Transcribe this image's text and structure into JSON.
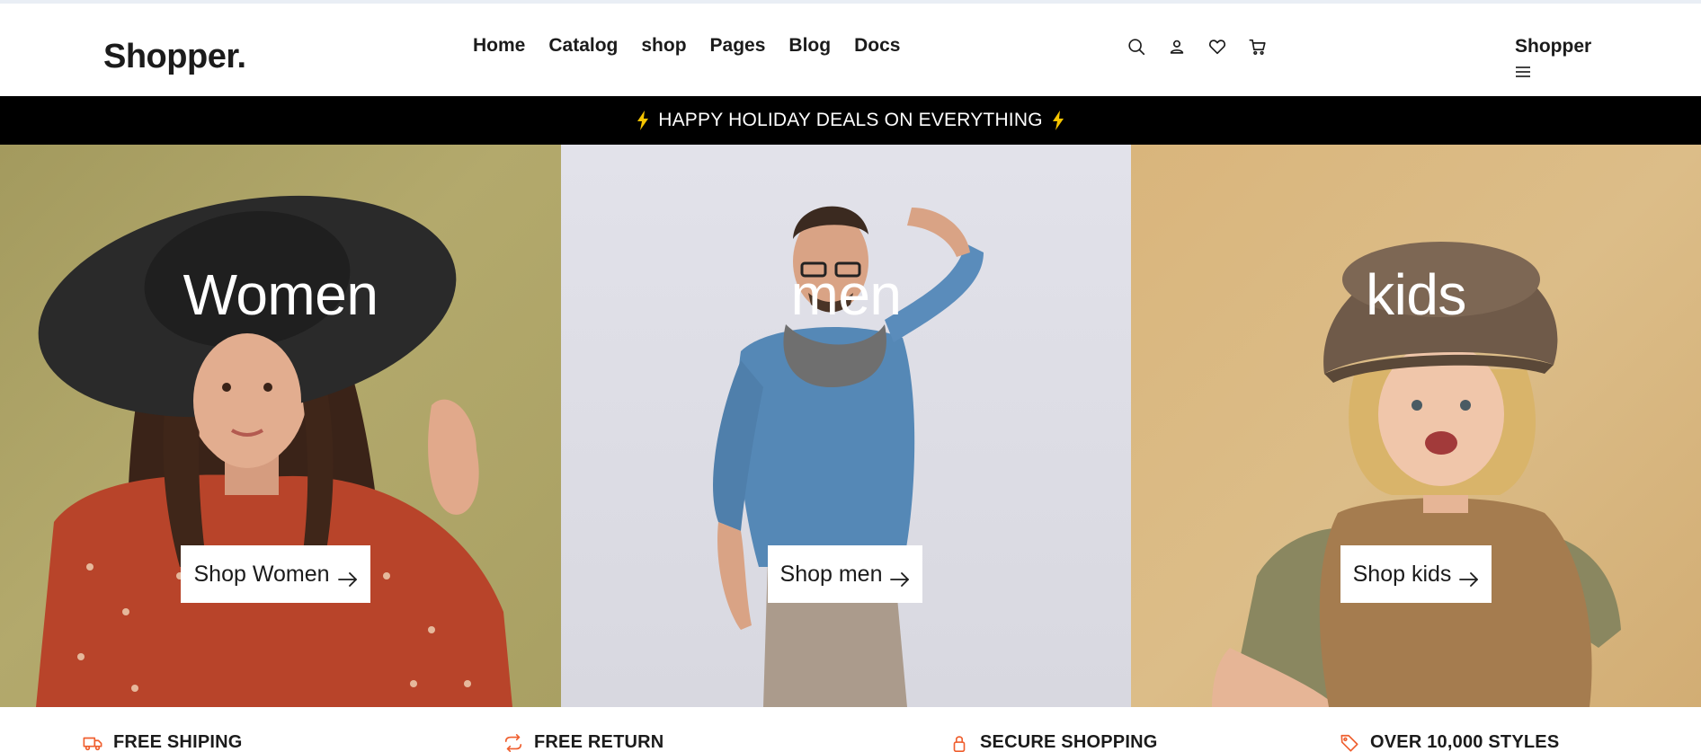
{
  "header": {
    "logo": "Shopper.",
    "nav": [
      "Home",
      "Catalog",
      "shop",
      "Pages",
      "Blog",
      "Docs"
    ],
    "icons": [
      "search-icon",
      "user-icon",
      "heart-icon",
      "cart-icon"
    ],
    "user_label": "Shopper"
  },
  "promo": {
    "text": "HAPPY HOLIDAY DEALS ON EVERYTHING",
    "accent_color": "#f5c400"
  },
  "hero": {
    "panels": [
      {
        "title": "Women",
        "button": "Shop Women"
      },
      {
        "title": "men",
        "button": "Shop men"
      },
      {
        "title": "kids",
        "button": "Shop kids"
      }
    ]
  },
  "features": [
    {
      "icon": "truck-icon",
      "label": "FREE SHIPING"
    },
    {
      "icon": "refresh-icon",
      "label": "FREE RETURN"
    },
    {
      "icon": "lock-icon",
      "label": "SECURE SHOPPING"
    },
    {
      "icon": "tag-icon",
      "label": "OVER 10,000 STYLES"
    }
  ],
  "colors": {
    "feature_icon": "#ef5f2f",
    "promo_bg": "#000000"
  }
}
